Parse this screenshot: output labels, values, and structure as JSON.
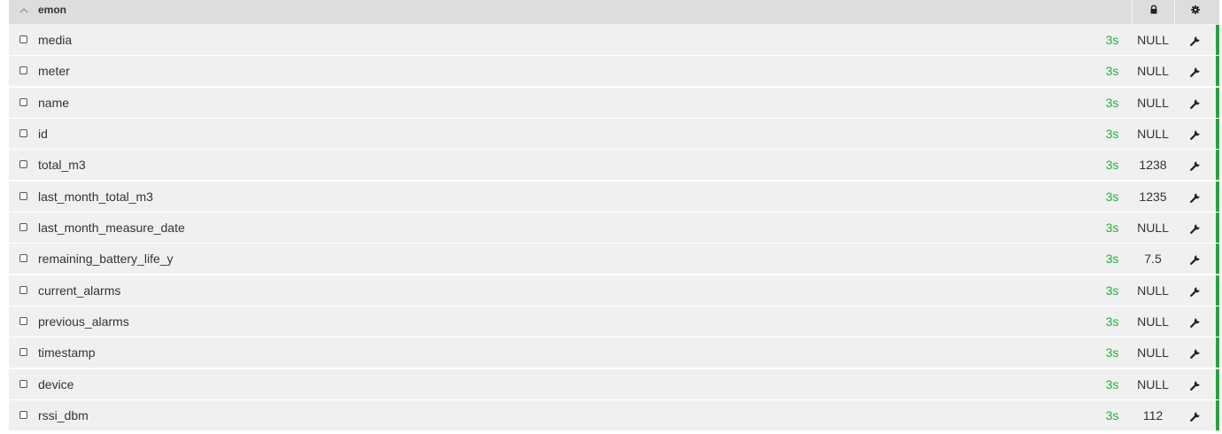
{
  "group": {
    "title": "emon",
    "collapse_icon": "chevron-up-icon",
    "lock_icon": "lock-icon",
    "settings_icon": "gear-icon"
  },
  "colors": {
    "accent": "#2aa140",
    "time_text": "#27ae3f",
    "row_bg": "#f0f0f0",
    "header_bg": "#dddddd"
  },
  "feeds": [
    {
      "name": "media",
      "time": "3s",
      "value": "NULL"
    },
    {
      "name": "meter",
      "time": "3s",
      "value": "NULL"
    },
    {
      "name": "name",
      "time": "3s",
      "value": "NULL"
    },
    {
      "name": "id",
      "time": "3s",
      "value": "NULL"
    },
    {
      "name": "total_m3",
      "time": "3s",
      "value": "1238"
    },
    {
      "name": "last_month_total_m3",
      "time": "3s",
      "value": "1235"
    },
    {
      "name": "last_month_measure_date",
      "time": "3s",
      "value": "NULL"
    },
    {
      "name": "remaining_battery_life_y",
      "time": "3s",
      "value": "7.5"
    },
    {
      "name": "current_alarms",
      "time": "3s",
      "value": "NULL"
    },
    {
      "name": "previous_alarms",
      "time": "3s",
      "value": "NULL"
    },
    {
      "name": "timestamp",
      "time": "3s",
      "value": "NULL"
    },
    {
      "name": "device",
      "time": "3s",
      "value": "NULL"
    },
    {
      "name": "rssi_dbm",
      "time": "3s",
      "value": "112"
    }
  ]
}
